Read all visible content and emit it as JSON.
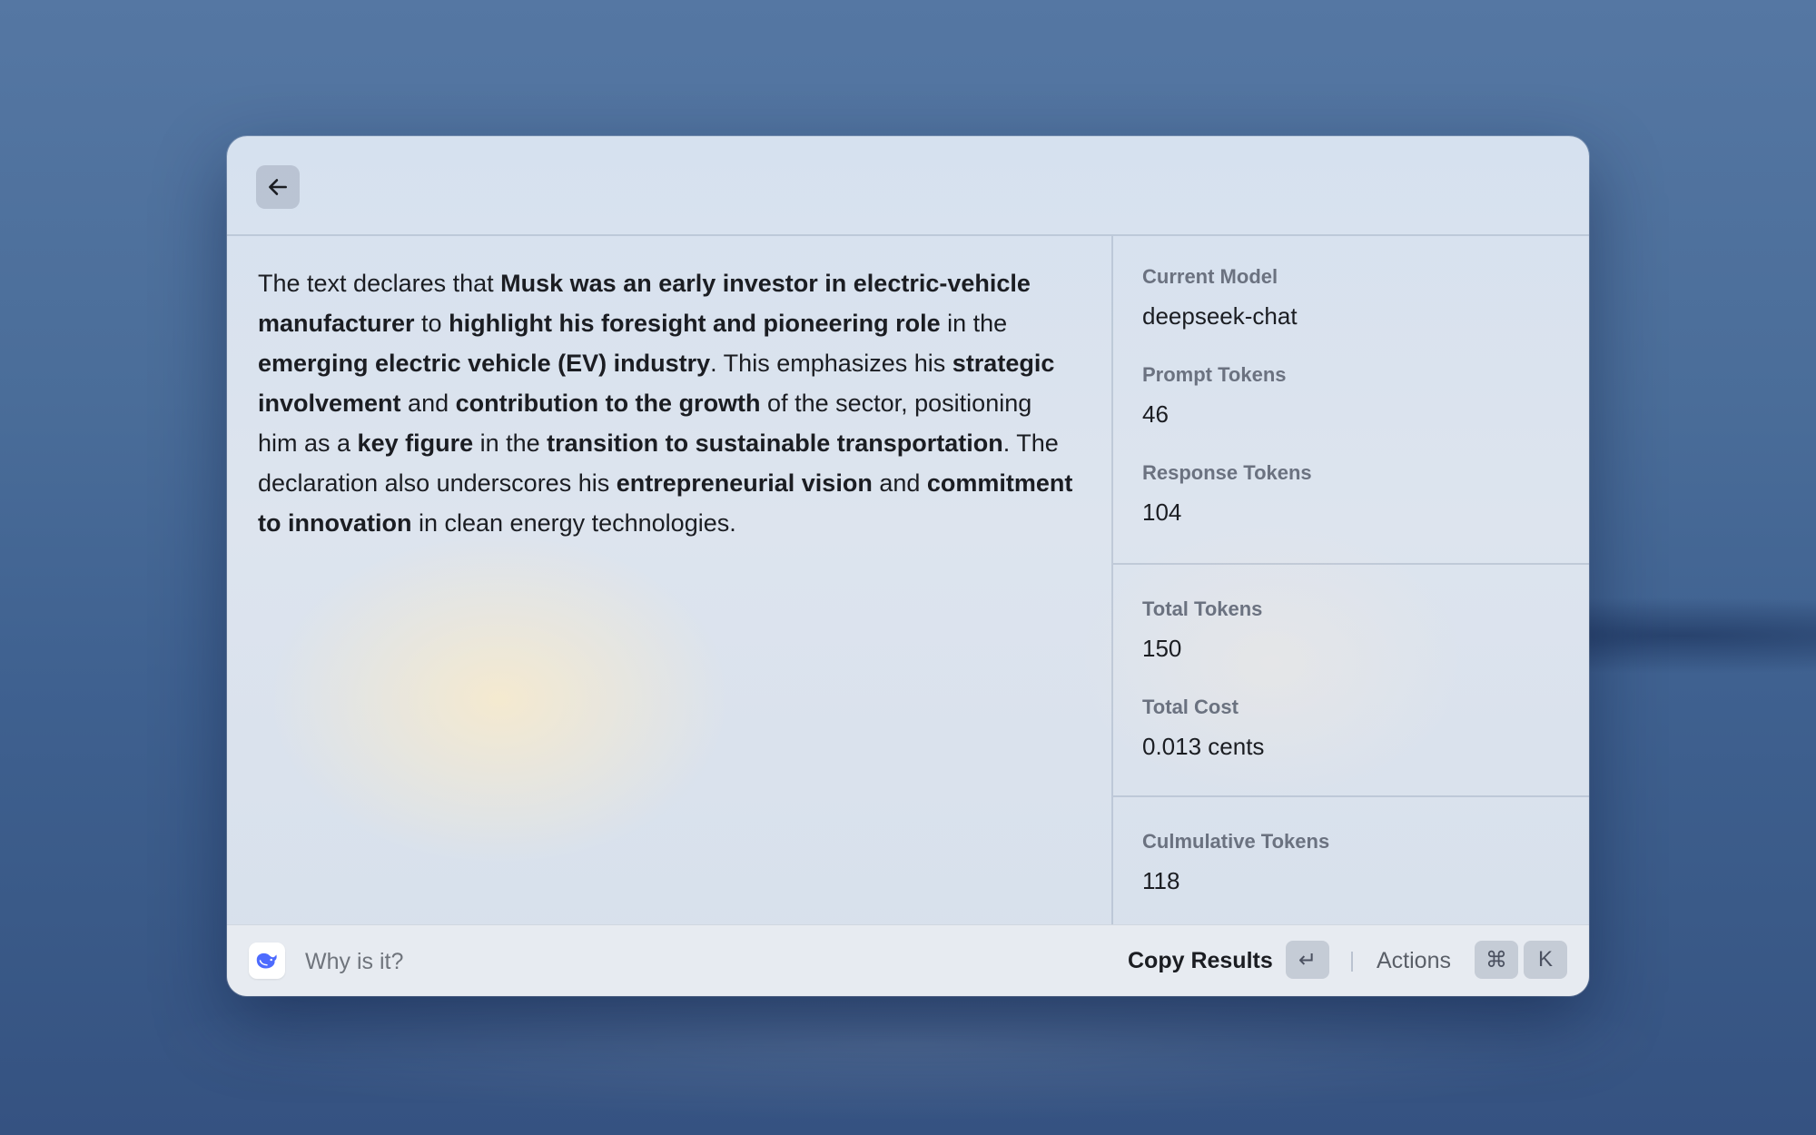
{
  "response": {
    "segments": [
      {
        "text": "The text declares that ",
        "bold": false
      },
      {
        "text": "Musk was an early investor in electric-vehicle manufacturer",
        "bold": true
      },
      {
        "text": " to ",
        "bold": false
      },
      {
        "text": "highlight his foresight and pioneering role",
        "bold": true
      },
      {
        "text": " in the ",
        "bold": false
      },
      {
        "text": "emerging electric vehicle (EV) industry",
        "bold": true
      },
      {
        "text": ". This emphasizes his ",
        "bold": false
      },
      {
        "text": "strategic involvement",
        "bold": true
      },
      {
        "text": " and ",
        "bold": false
      },
      {
        "text": "contribution to the growth",
        "bold": true
      },
      {
        "text": " of the sector, positioning him as a ",
        "bold": false
      },
      {
        "text": "key figure",
        "bold": true
      },
      {
        "text": " in the ",
        "bold": false
      },
      {
        "text": "transition to sustainable transportation",
        "bold": true
      },
      {
        "text": ". The declaration also underscores his ",
        "bold": false
      },
      {
        "text": "entrepreneurial vision",
        "bold": true
      },
      {
        "text": " and ",
        "bold": false
      },
      {
        "text": "commitment to innovation",
        "bold": true
      },
      {
        "text": " in clean energy technologies.",
        "bold": false
      }
    ]
  },
  "metadata": {
    "current_model": {
      "label": "Current Model",
      "value": "deepseek-chat"
    },
    "prompt_tokens": {
      "label": "Prompt Tokens",
      "value": "46"
    },
    "response_tokens": {
      "label": "Response Tokens",
      "value": "104"
    },
    "total_tokens": {
      "label": "Total Tokens",
      "value": "150"
    },
    "total_cost": {
      "label": "Total Cost",
      "value": "0.013 cents"
    },
    "cumulative_tokens": {
      "label": "Culmulative Tokens",
      "value": "118"
    }
  },
  "footer": {
    "input_placeholder": "Why is it?",
    "copy_label": "Copy Results",
    "enter_key": "↵",
    "actions_label": "Actions",
    "cmd_key": "⌘",
    "k_key": "K"
  },
  "icons": {
    "back": "arrow-left-icon",
    "app": "deepseek-whale-icon"
  },
  "colors": {
    "accent": "#4d6bfe",
    "text": "#1b1d22",
    "label": "#6b7280"
  }
}
